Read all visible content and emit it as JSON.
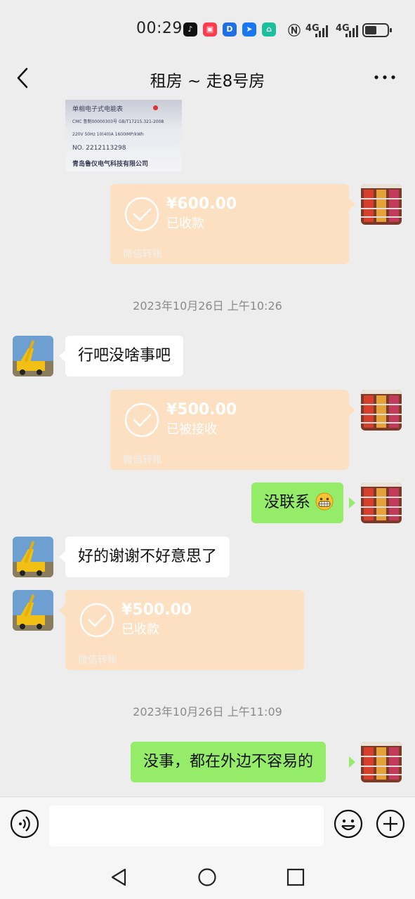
{
  "status_bar": {
    "time": "00:29",
    "network_1": "4G",
    "network_2": "4G",
    "app_icons": [
      "tiktok-icon",
      "red-app-icon",
      "blue-d-app-icon",
      "blue-arrow-app-icon",
      "teal-home-app-icon"
    ],
    "system_icons": [
      "nfc-icon",
      "signal-icon",
      "signal-icon",
      "battery-icon"
    ]
  },
  "header": {
    "title": "租房 ~ 走8号房",
    "back_icon": "chevron-left-icon",
    "more_icon": "more-dots-icon"
  },
  "image_message": {
    "meter_model_line": "单相电子式电能表",
    "meter_cert": "CMC 鲁制00000303号   GB/T17215.321-2008",
    "meter_specs": "220V   50Hz   10(40)A   1600IMP/kWh",
    "meter_no": "NO. 2212113298",
    "meter_maker": "青岛鲁仪电气科技有限公司"
  },
  "messages": [
    {
      "type": "transfer",
      "side": "right",
      "amount": "¥600.00",
      "status": "已收款",
      "footer": "微信转账"
    },
    {
      "type": "timestamp",
      "text": "2023年10月26日 上午10:26"
    },
    {
      "type": "text",
      "side": "left",
      "text": "行吧没啥事吧"
    },
    {
      "type": "transfer",
      "side": "right",
      "amount": "¥500.00",
      "status": "已被接收",
      "footer": "微信转账"
    },
    {
      "type": "text",
      "side": "right",
      "text": "没联系",
      "emoji": "grinning-face-emoji"
    },
    {
      "type": "text",
      "side": "left",
      "text": "好的谢谢不好意思了"
    },
    {
      "type": "transfer",
      "side": "left",
      "amount": "¥500.00",
      "status": "已收款",
      "footer": "微信转账"
    },
    {
      "type": "timestamp",
      "text": "2023年10月26日 上午11:09"
    },
    {
      "type": "text",
      "side": "right",
      "text": "没事，都在外边不容易的"
    }
  ],
  "input_bar": {
    "voice_icon": "voice-icon",
    "emoji_icon": "emoji-icon",
    "plus_icon": "plus-icon"
  },
  "nav_bar": {
    "icons": [
      "nav-back-icon",
      "nav-home-icon",
      "nav-recents-icon"
    ]
  },
  "colors": {
    "chat_background": "#ededed",
    "self_bubble": "#95ec69",
    "other_bubble": "#ffffff",
    "transfer_card": "#fce0c1",
    "timestamp_text": "#8a8a8a"
  }
}
